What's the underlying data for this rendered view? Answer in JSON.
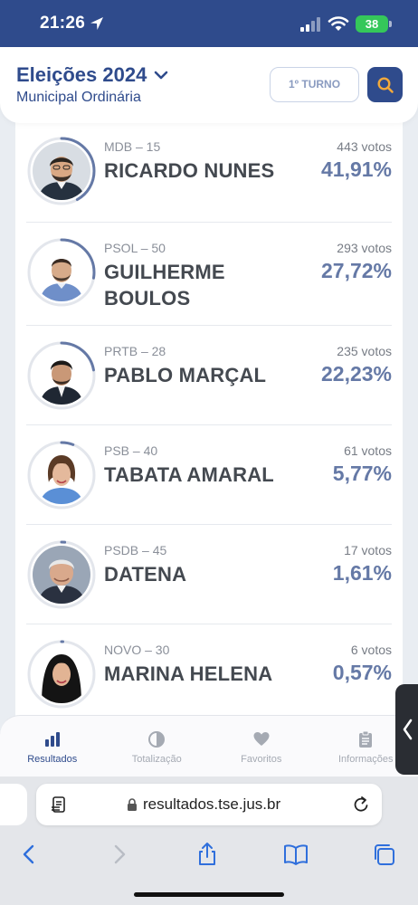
{
  "status": {
    "time": "21:26",
    "battery": "38"
  },
  "header": {
    "title": "Eleições 2024",
    "subtitle": "Municipal Ordinária",
    "turno_label": "1º TURNO"
  },
  "candidates": [
    {
      "party": "MDB – 15",
      "name": "RICARDO NUNES",
      "votes": "443 votos",
      "percent": "41,91%",
      "share": 41.91
    },
    {
      "party": "PSOL – 50",
      "name": "GUILHERME BOULOS",
      "votes": "293 votos",
      "percent": "27,72%",
      "share": 27.72
    },
    {
      "party": "PRTB – 28",
      "name": "PABLO MARÇAL",
      "votes": "235 votos",
      "percent": "22,23%",
      "share": 22.23
    },
    {
      "party": "PSB – 40",
      "name": "TABATA AMARAL",
      "votes": "61 votos",
      "percent": "5,77%",
      "share": 5.77
    },
    {
      "party": "PSDB – 45",
      "name": "DATENA",
      "votes": "17 votos",
      "percent": "1,61%",
      "share": 1.61
    },
    {
      "party": "NOVO – 30",
      "name": "MARINA HELENA",
      "votes": "6 votos",
      "percent": "0,57%",
      "share": 0.57
    }
  ],
  "tabs": [
    {
      "label": "Resultados",
      "icon": "bar-chart-icon",
      "active": true
    },
    {
      "label": "Totalização",
      "icon": "pie-chart-icon",
      "active": false
    },
    {
      "label": "Favoritos",
      "icon": "heart-icon",
      "active": false
    },
    {
      "label": "Informações",
      "icon": "clipboard-icon",
      "active": false
    }
  ],
  "browser": {
    "url": "resultados.tse.jus.br"
  },
  "colors": {
    "brand_blue": "#2f4b8c",
    "percent_blue": "#6579a6",
    "battery_green": "#35c75a",
    "search_icon": "#f2a93b"
  }
}
